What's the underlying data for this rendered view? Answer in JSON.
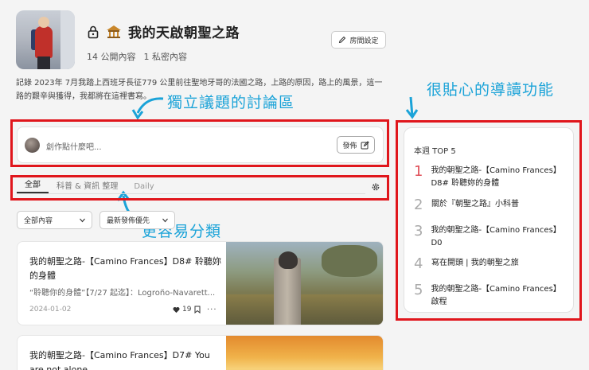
{
  "header": {
    "title": "我的天啟朝聖之路",
    "public_count": "14 公開內容",
    "private_count": "1 私密內容",
    "settings_label": "房間設定",
    "description": "記錄 2023年 7月我踏上西班牙長征779 公里前往聖地牙哥的法國之路，上路的原因，路上的風景，這一路的艱辛與獲得，我都將在這裡書寫。"
  },
  "annotations": {
    "discussion": "獨立議題的討論區",
    "guide": "很貼心的導讀功能",
    "classify": "更容易分類"
  },
  "composer": {
    "placeholder": "創作點什麼吧...",
    "post_label": "發佈"
  },
  "tabs": [
    {
      "label": "全部"
    },
    {
      "label": "科普 & 資訊 整理"
    },
    {
      "label": "Daily"
    }
  ],
  "filters": {
    "content_type": "全部內容",
    "sort": "最新發佈優先"
  },
  "posts": [
    {
      "title": "我的朝聖之路-【Camino Frances】D8# 聆聽妳的身體",
      "excerpt": "“聆聽你的身體”【7/27 起迄】：Logroño-Navarett...",
      "date": "2024-01-02",
      "likes": "19"
    },
    {
      "title": "我的朝聖之路-【Camino Frances】D7# You are not alone."
    }
  ],
  "sidebar": {
    "title": "本週 TOP 5",
    "items": [
      {
        "rank": "1",
        "text": "我的朝聖之路-【Camino Frances】D8# 聆聽妳的身體"
      },
      {
        "rank": "2",
        "text": "關於『朝聖之路』小科普"
      },
      {
        "rank": "3",
        "text": "我的朝聖之路-【Camino Frances】D0"
      },
      {
        "rank": "4",
        "text": "寫在開頭 | 我的朝聖之旅"
      },
      {
        "rank": "5",
        "text": "我的朝聖之路-【Camino Frances】啟程"
      }
    ]
  },
  "colors": {
    "annotation": "#1ba3d8",
    "highlight_box": "#e0161c",
    "rank_first": "#e0505a"
  }
}
